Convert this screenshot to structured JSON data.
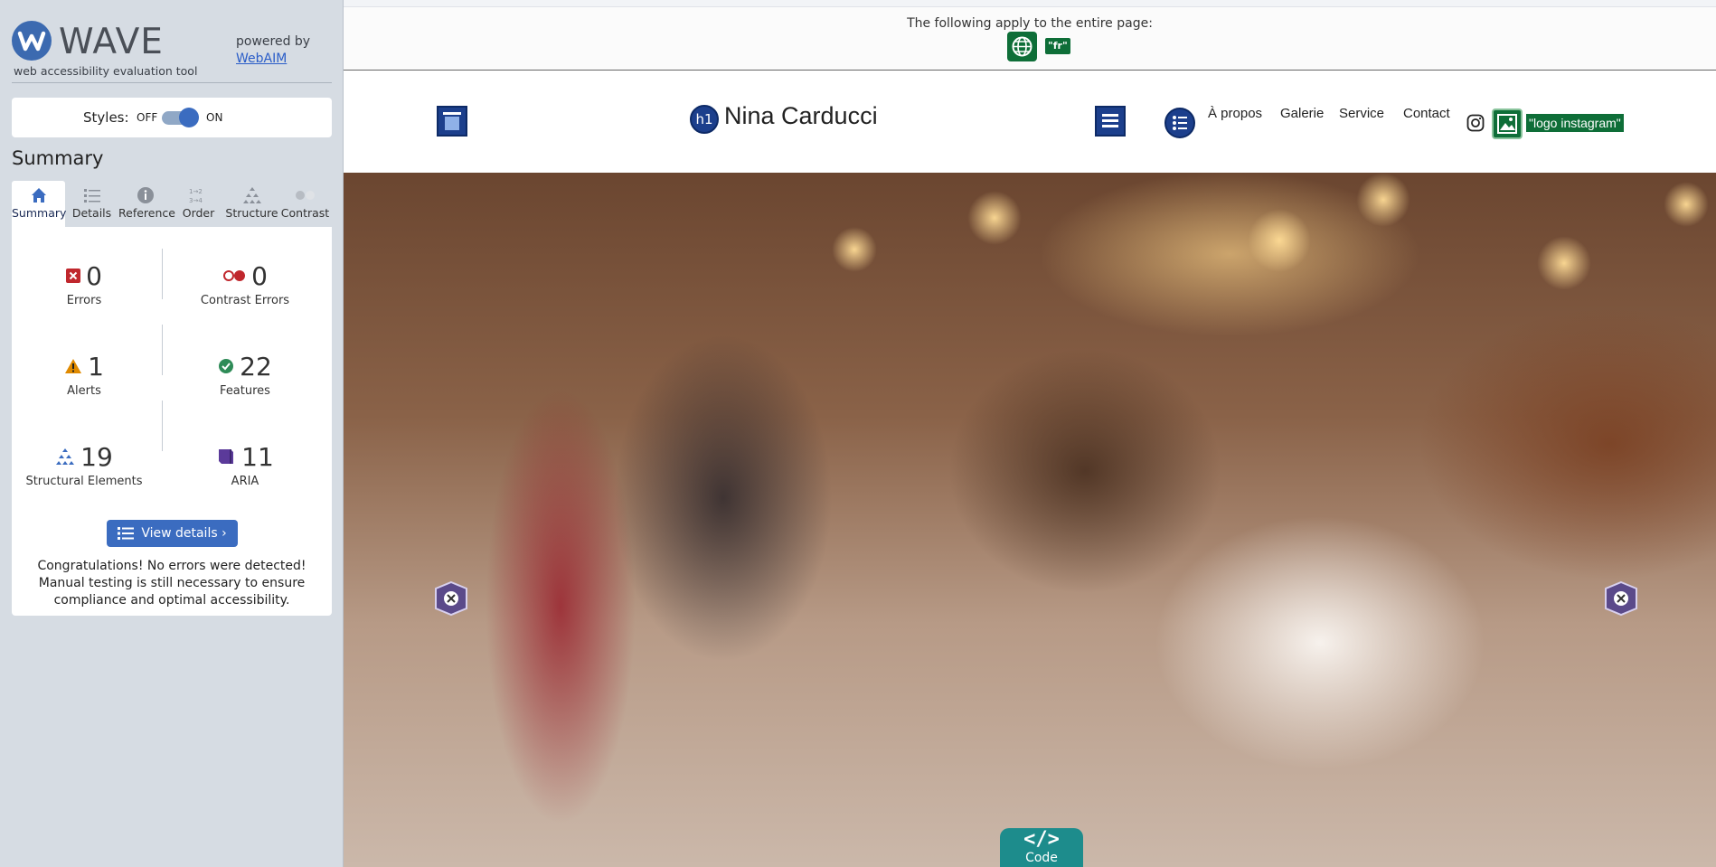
{
  "wave": {
    "brand": "WAVE",
    "tagline": "web accessibility evaluation tool",
    "powered_by": "powered by",
    "powered_link": "WebAIM",
    "styles_label": "Styles:",
    "styles_off": "OFF",
    "styles_on": "ON",
    "summary_heading": "Summary",
    "tabs": [
      {
        "label": "Summary",
        "icon": "home-icon",
        "active": true
      },
      {
        "label": "Details",
        "icon": "list-icon"
      },
      {
        "label": "Reference",
        "icon": "info-icon"
      },
      {
        "label": "Order",
        "icon": "order-icon"
      },
      {
        "label": "Structure",
        "icon": "structure-icon"
      },
      {
        "label": "Contrast",
        "icon": "contrast-icon"
      }
    ],
    "stats": {
      "errors": {
        "count": "0",
        "label": "Errors",
        "color": "#c0272d"
      },
      "contrast_errors": {
        "count": "0",
        "label": "Contrast Errors",
        "color": "#c0272d"
      },
      "alerts": {
        "count": "1",
        "label": "Alerts",
        "color": "#e08a00"
      },
      "features": {
        "count": "22",
        "label": "Features",
        "color": "#2e8b57"
      },
      "structural": {
        "count": "19",
        "label": "Structural Elements",
        "color": "#3b6cc0"
      },
      "aria": {
        "count": "11",
        "label": "ARIA",
        "color": "#5b3a9a"
      }
    },
    "view_details": "View details ›",
    "congrats": "Congratulations! No errors were detected! Manual testing is still necessary to ensure compliance and optimal accessibility."
  },
  "page_banner": {
    "text": "The following apply to the entire page:",
    "lang_icon": "globe-icon",
    "lang_value": "\"fr\""
  },
  "site": {
    "h1_badge": "h1",
    "title": "Nina Carducci",
    "nav": [
      "À propos",
      "Galerie",
      "Service",
      "Contact"
    ],
    "instagram_alt": "\"logo instagram\""
  },
  "code_tab": {
    "symbol": "</>",
    "label": "Code"
  },
  "colors": {
    "wave_blue": "#3b6cc0",
    "feature_green": "#0e6e38",
    "code_teal": "#1d8c8c",
    "aria_purple": "#5b3a9a"
  }
}
